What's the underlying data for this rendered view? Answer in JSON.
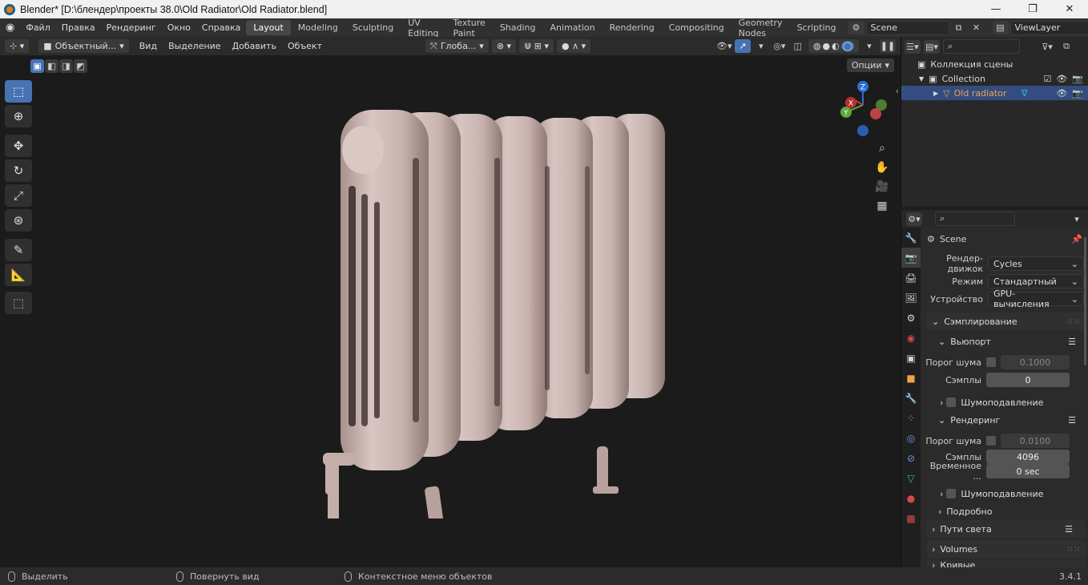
{
  "titlebar": {
    "title": "Blender* [D:\\блендер\\проекты 38.0\\Old Radiator\\Old Radiator.blend]"
  },
  "menu": [
    "Файл",
    "Правка",
    "Рендеринг",
    "Окно",
    "Справка"
  ],
  "workspaces": [
    {
      "label": "Layout",
      "active": true
    },
    {
      "label": "Modeling"
    },
    {
      "label": "Sculpting"
    },
    {
      "label": "UV Editing"
    },
    {
      "label": "Texture Paint"
    },
    {
      "label": "Shading"
    },
    {
      "label": "Animation"
    },
    {
      "label": "Rendering"
    },
    {
      "label": "Compositing"
    },
    {
      "label": "Geometry Nodes"
    },
    {
      "label": "Scripting"
    }
  ],
  "scene_field": "Scene",
  "viewlayer_field": "ViewLayer",
  "viewport_header": {
    "mode": "Объектный...",
    "menus": [
      "Вид",
      "Выделение",
      "Добавить",
      "Объект"
    ],
    "transform_orientation": "Глоба...",
    "options": "Опции"
  },
  "gizmo": {
    "x": "X",
    "y": "Y",
    "z": "Z"
  },
  "outliner": {
    "scene_collection": "Коллекция сцены",
    "collection": "Collection",
    "object": "Old radiator"
  },
  "properties": {
    "context": "Scene",
    "render_engine_label": "Рендер-движок",
    "render_engine": "Cycles",
    "mode_label": "Режим",
    "mode": "Стандартный",
    "device_label": "Устройство",
    "device": "GPU-вычисления",
    "sampling": "Сэмплирование",
    "viewport": "Вьюпорт",
    "noise_threshold_label": "Порог шума",
    "viewport_noise_threshold": "0.1000",
    "samples_label": "Сэмплы",
    "viewport_samples": "0",
    "denoise": "Шумоподавление",
    "render": "Рендеринг",
    "render_noise_threshold": "0.0100",
    "render_samples": "4096",
    "time_limit_label": "Временное ...",
    "time_limit": "0 sec",
    "render_denoise": "Шумоподавление",
    "advanced": "Подробно",
    "light_paths": "Пути света",
    "volumes": "Volumes",
    "curves": "Кривые"
  },
  "status": {
    "select": "Выделить",
    "rotate": "Повернуть вид",
    "context_menu": "Контекстное меню объектов",
    "version": "3.4.1"
  },
  "colors": {
    "accent": "#4772b3",
    "radiator": "#cdb8b4",
    "active_tab": "#474747"
  }
}
